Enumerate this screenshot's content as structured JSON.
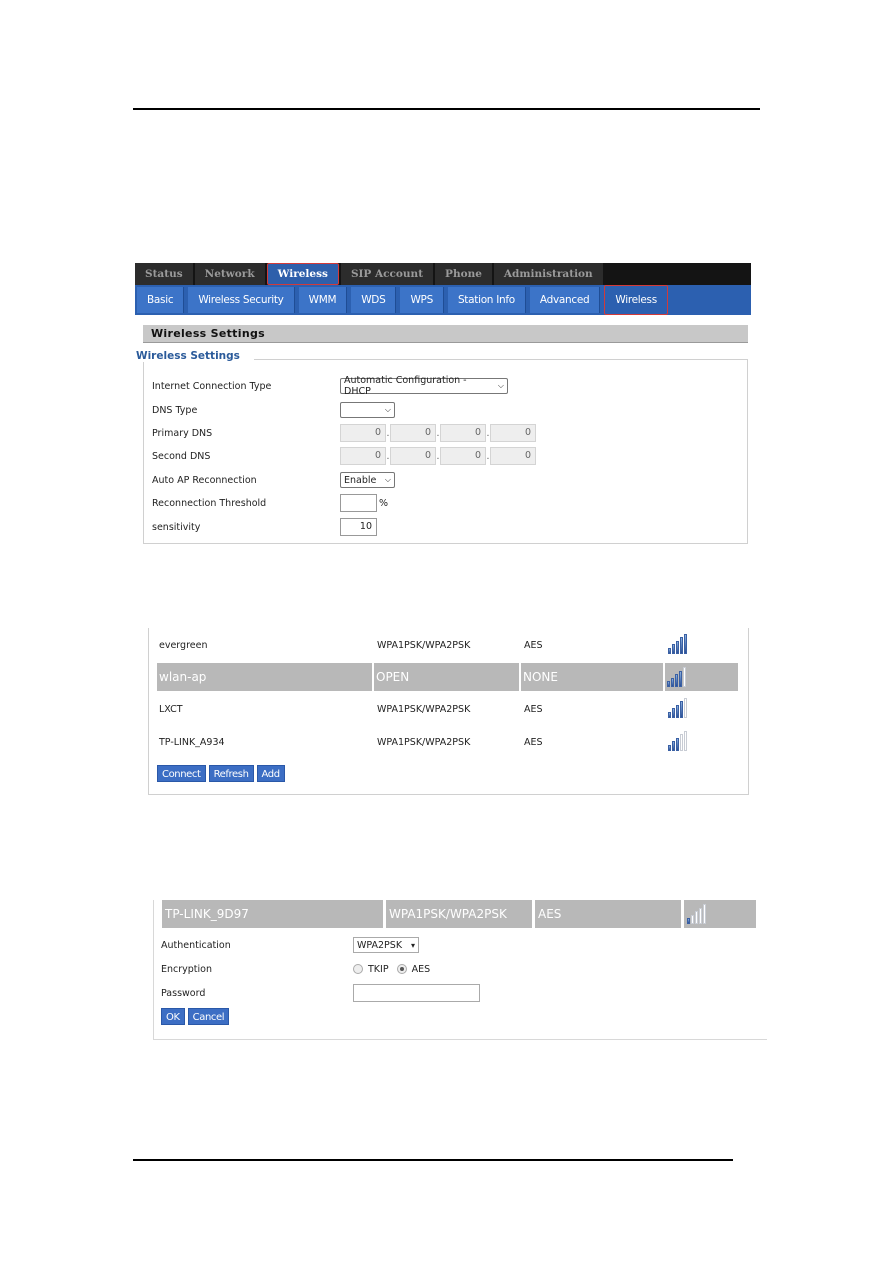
{
  "main_nav": [
    {
      "label": "Status",
      "active": false
    },
    {
      "label": "Network",
      "active": false
    },
    {
      "label": "Wireless",
      "active": true
    },
    {
      "label": "SIP Account",
      "active": false
    },
    {
      "label": "Phone",
      "active": false
    },
    {
      "label": "Administration",
      "active": false
    }
  ],
  "sub_nav": [
    {
      "label": "Basic",
      "active": false
    },
    {
      "label": "Wireless Security",
      "active": false
    },
    {
      "label": "WMM",
      "active": false
    },
    {
      "label": "WDS",
      "active": false
    },
    {
      "label": "WPS",
      "active": false
    },
    {
      "label": "Station Info",
      "active": false
    },
    {
      "label": "Advanced",
      "active": false
    },
    {
      "label": "Wireless",
      "active": true
    }
  ],
  "section_title": "Wireless Settings",
  "fieldset_legend": "Wireless Settings",
  "settings": {
    "internet_connection_type": {
      "label": "Internet Connection Type",
      "value": "Automatic Configuration - DHCP"
    },
    "dns_type": {
      "label": "DNS Type",
      "value": ""
    },
    "primary_dns": {
      "label": "Primary DNS",
      "octets": [
        "0",
        "0",
        "0",
        "0"
      ]
    },
    "second_dns": {
      "label": "Second DNS",
      "octets": [
        "0",
        "0",
        "0",
        "0"
      ]
    },
    "auto_ap_reconnection": {
      "label": "Auto AP Reconnection",
      "value": "Enable"
    },
    "reconnection_threshold": {
      "label": "Reconnection Threshold",
      "value": "",
      "unit": "%"
    },
    "sensitivity": {
      "label": "sensitivity",
      "value": "10"
    }
  },
  "ap_list": [
    {
      "ssid": "evergreen",
      "auth": "WPA1PSK/WPA2PSK",
      "encryption": "AES",
      "signal_bars": 5,
      "selected": false
    },
    {
      "ssid": "wlan-ap",
      "auth": "OPEN",
      "encryption": "NONE",
      "signal_bars": 4,
      "selected": true
    },
    {
      "ssid": "LXCT",
      "auth": "WPA1PSK/WPA2PSK",
      "encryption": "AES",
      "signal_bars": 4,
      "selected": false
    },
    {
      "ssid": "TP-LINK_A934",
      "auth": "WPA1PSK/WPA2PSK",
      "encryption": "AES",
      "signal_bars": 3,
      "selected": false
    }
  ],
  "signal_max_bars": 5,
  "ap_buttons": {
    "connect": "Connect",
    "refresh": "Refresh",
    "add": "Add"
  },
  "connect_dialog": {
    "ap": {
      "ssid": "TP-LINK_9D97",
      "auth": "WPA1PSK/WPA2PSK",
      "encryption": "AES",
      "signal_bars": 1
    },
    "authentication": {
      "label": "Authentication",
      "value": "WPA2PSK"
    },
    "encryption": {
      "label": "Encryption",
      "options": [
        "TKIP",
        "AES"
      ],
      "selected": "AES"
    },
    "password": {
      "label": "Password",
      "value": ""
    },
    "ok_label": "OK",
    "cancel_label": "Cancel"
  },
  "icons": {
    "dropdown": "▾",
    "chevron": "⌄"
  }
}
